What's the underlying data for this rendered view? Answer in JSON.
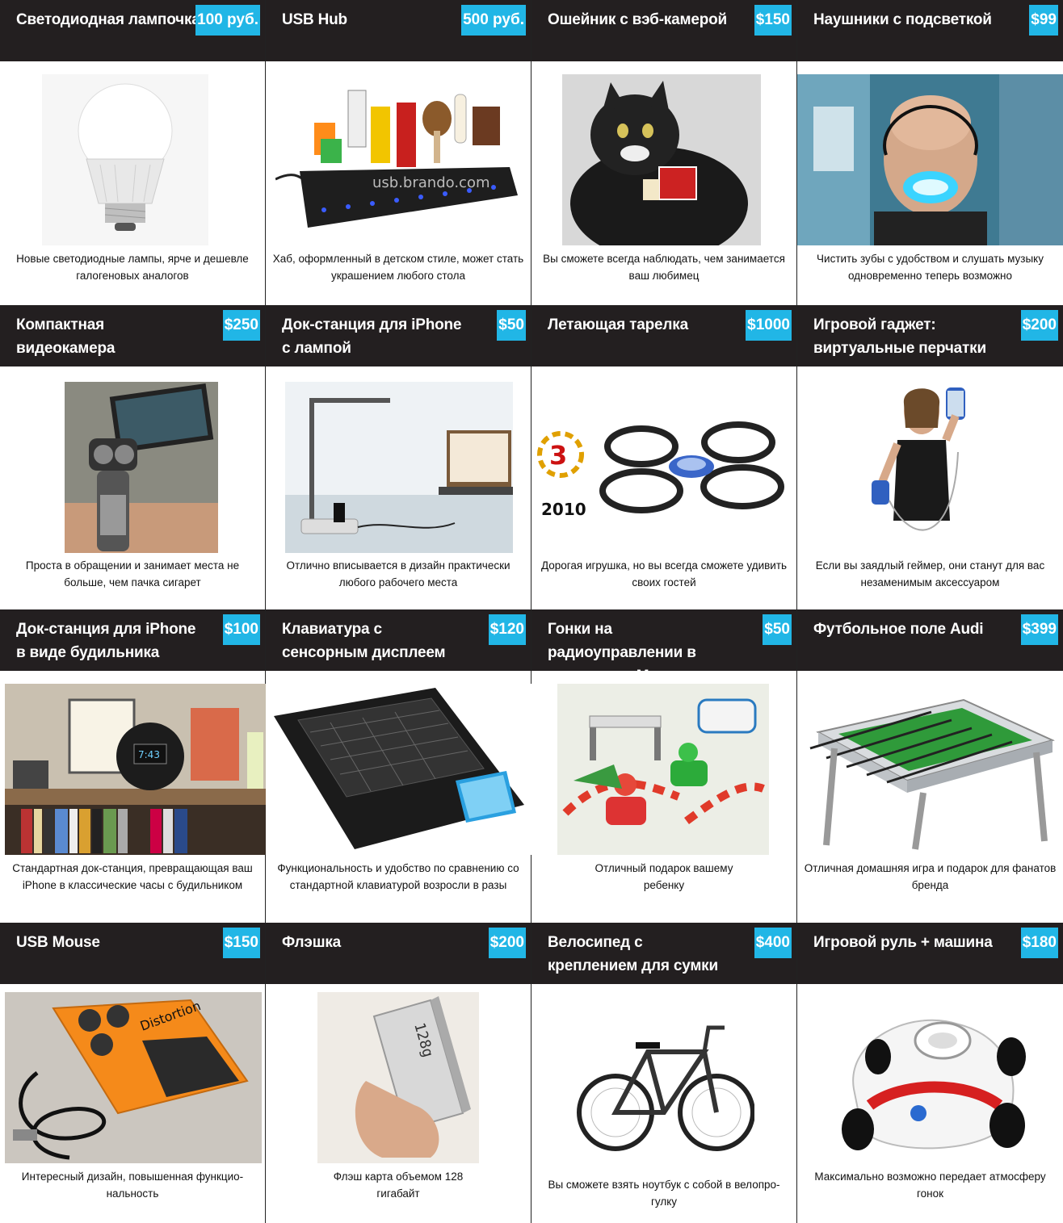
{
  "colors": {
    "header_bg": "#231f20",
    "price_bg": "#21b6e6",
    "text": "#111111"
  },
  "rows": [
    [
      {
        "title": "Светодиодная лампочка",
        "price": "100 руб.",
        "desc": "Новые светодиодные лампы, ярче и дешевле галогеновых аналогов",
        "icon": "led-bulb-image"
      },
      {
        "title": "USB Hub",
        "price": "500 руб.",
        "desc": "Хаб, оформленный в детском стиле, может стать украшением любого стола",
        "icon": "usb-hub-image"
      },
      {
        "title": "Ошейник с вэб-камерой",
        "price": "$150",
        "desc": "Вы сможете всегда наблюдать, чем занимается ваш любимец",
        "icon": "cat-webcam-collar-image"
      },
      {
        "title": "Наушники с подсветкой",
        "price": "$99",
        "desc": "Чистить зубы с удобством и слушать музыку одновременно теперь возможно",
        "icon": "glowing-headset-image"
      }
    ],
    [
      {
        "title": "Компактная видеокамера",
        "price": "$250",
        "desc": "Проста в обращении и занимает места не больше, чем пачка сигарет",
        "icon": "compact-camcorder-image"
      },
      {
        "title": "Док-станция для iPhone с лампой",
        "price": "$50",
        "desc": "Отлично вписывается в дизайн практически любого рабочего места",
        "icon": "iphone-dock-lamp-image"
      },
      {
        "title": "Летающая тарелка",
        "price": "$1000",
        "desc": "Дорогая игрушка, но вы всегда сможете удивить своих гостей",
        "icon": "quadcopter-image"
      },
      {
        "title": "Игровой гаджет: виртуальные перчатки",
        "price": "$200",
        "desc": "Если вы заядлый геймер, они станут для вас незаменимым аксессуаром",
        "icon": "virtual-gloves-image"
      }
    ],
    [
      {
        "title": "Док-станция для iPhone в виде будильника",
        "price": "$100",
        "desc": "Стандартная док-станция, превращающая ваш iPhone в классические часы с будильником",
        "icon": "alarm-clock-dock-image"
      },
      {
        "title": "Клавиатура с сенсорным дисплеем",
        "price": "$120",
        "desc": "Функциональность и удобство по сравнению со стандартной клавиатурой возросли в разы",
        "icon": "touch-keyboard-image"
      },
      {
        "title": "Гонки на радиоуправлении в стиле игры Марио",
        "price": "$50",
        "desc": "Отличный подарок вашему ребенку",
        "icon": "mario-rc-race-image"
      },
      {
        "title": "Футбольное поле Audi",
        "price": "$399",
        "desc": "Отличная домашняя игра и подарок для фанатов бренда",
        "icon": "foosball-table-image"
      }
    ],
    [
      {
        "title": "USB Mouse",
        "price": "$150",
        "desc": "Интересный дизайн, повышенная функцио-нальность",
        "icon": "pedal-mouse-image"
      },
      {
        "title": "Флэшка",
        "price": "$200",
        "desc": "Флэш карта объемом 128 гигабайт",
        "icon": "flash-drive-image"
      },
      {
        "title": "Велосипед с креплением для сумки",
        "price": "$400",
        "desc": "Вы сможете взять ноутбук с собой в велопро-гулку",
        "icon": "bicycle-image"
      },
      {
        "title": "Игровой руль + машина",
        "price": "$180",
        "desc": "Максимально возможно передает атмосферу гонок",
        "icon": "kart-wheel-image"
      }
    ]
  ],
  "images": {
    "hub_logo": "usb.brando.com",
    "drone_logo": "2010",
    "flash_label": "128g",
    "clock_time": "7:43",
    "pedal_label": "Distortion"
  }
}
